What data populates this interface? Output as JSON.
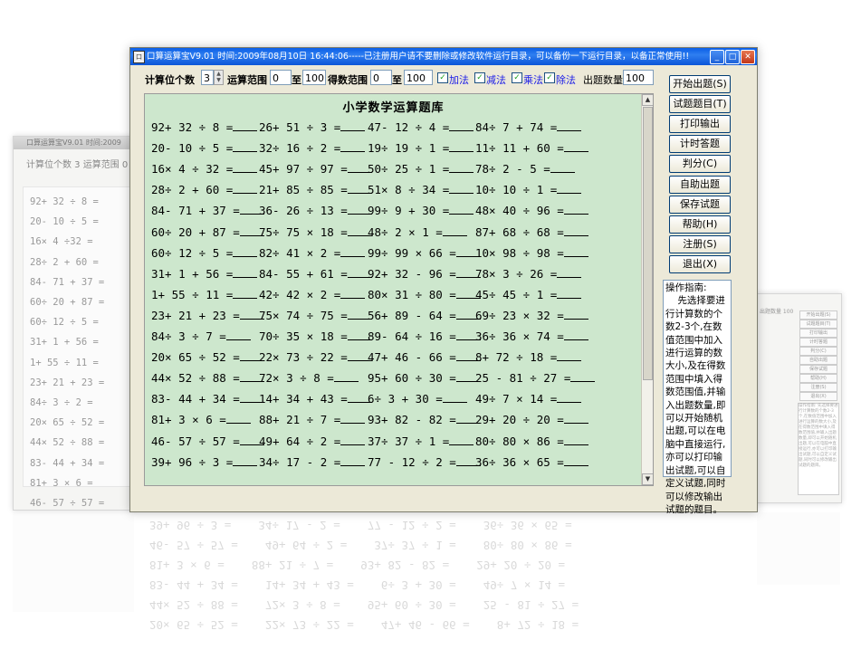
{
  "window": {
    "title": "口算运算宝V9.01   时间:2009年08月10日  16:44:06-----已注册用户请不要删除或修改软件运行目录，可以备份一下运行目录，以备正常使用!!",
    "icon_glyph": "口",
    "min_glyph": "_",
    "max_glyph": "□",
    "close_glyph": "✕"
  },
  "toolbar": {
    "digits_label": "计算位个数",
    "digits_value": "3",
    "range_label": "运算范围",
    "range_from": "0",
    "to_label_1": "至",
    "range_to": "100",
    "result_label": "得数范围",
    "result_from": "0",
    "to_label_2": "至",
    "result_to": "100",
    "ops": {
      "add": "加法",
      "sub": "减法",
      "mul": "乘法",
      "div": "除法"
    },
    "check_glyph": "✓",
    "count_label": "出题数量",
    "count_value": "100"
  },
  "question_area": {
    "title": "小学数学运算题库",
    "rows": [
      [
        "92+ 32 ÷ 8 =",
        "26+ 51 ÷ 3 =",
        "47- 12 ÷ 4 =",
        "84÷ 7 + 74 ="
      ],
      [
        "20- 10 ÷ 5 =",
        "32÷ 16 ÷ 2 =",
        "19÷ 19 ÷ 1 =",
        "11÷ 11 + 60 ="
      ],
      [
        "16× 4 ÷ 32 =",
        "45+ 97 ÷ 97 =",
        "50÷ 25 ÷ 1 =",
        "78÷ 2 - 5 ="
      ],
      [
        "28÷ 2 + 60 =",
        "21+ 85 ÷ 85 =",
        "51× 8 ÷ 34 =",
        "10÷ 10 ÷ 1 ="
      ],
      [
        "84- 71 + 37 =",
        "36- 26 ÷ 13 =",
        "99÷ 9 + 30 =",
        "48× 40 ÷ 96 ="
      ],
      [
        "60÷ 20 + 87 =",
        "75÷ 75 × 18 =",
        "48÷ 2 × 1 =",
        "87+ 68 ÷ 68 ="
      ],
      [
        "60÷ 12 ÷ 5 =",
        "82÷ 41 × 2 =",
        "99÷ 99 × 66 =",
        "10× 98 ÷ 98 ="
      ],
      [
        "31+ 1 + 56 =",
        "84- 55 + 61 =",
        "92+ 32 - 96 =",
        "78× 3 ÷ 26 ="
      ],
      [
        "1+ 55 ÷ 11 =",
        "42÷ 42 × 2 =",
        "80× 31 ÷ 80 =",
        "45÷ 45 ÷ 1 ="
      ],
      [
        "23+ 21 + 23 =",
        "75× 74 ÷ 75 =",
        "56+ 89 - 64 =",
        "69÷ 23 × 32 ="
      ],
      [
        "84÷ 3 ÷ 7 =",
        "70÷ 35 × 18 =",
        "89- 64 ÷ 16 =",
        "36÷ 36 × 74 ="
      ],
      [
        "20× 65 ÷ 52 =",
        "22× 73 ÷ 22 =",
        "47+ 46 - 66 =",
        "8+ 72 ÷ 18 ="
      ],
      [
        "44× 52 ÷ 88 =",
        "72× 3 ÷ 8 =",
        "95+ 60 ÷ 30 =",
        "25 - 81 ÷ 27 ="
      ],
      [
        "83- 44 + 34 =",
        "14+ 34 + 43 =",
        "6÷ 3 + 30 =",
        "49÷ 7 × 14 ="
      ],
      [
        "81+ 3 × 6 =",
        "88+ 21 ÷ 7 =",
        "93+ 82 - 82 =",
        "29+ 20 ÷ 20 ="
      ],
      [
        "46- 57 ÷ 57 =",
        "49+ 64 ÷ 2 =",
        "37÷ 37 ÷ 1 =",
        "80÷ 80 × 86 ="
      ],
      [
        "39+ 96 ÷ 3 =",
        "34÷ 17 - 2 =",
        "77 - 12 ÷ 2 =",
        "36÷ 36 × 65 ="
      ]
    ],
    "scroll_up": "▲",
    "scroll_down": "▼"
  },
  "buttons": [
    {
      "label": "开始出题(S)",
      "name": "start-button"
    },
    {
      "label": "试题题目(T)",
      "name": "questions-button"
    },
    {
      "label": "打印输出",
      "name": "print-button"
    },
    {
      "label": "计时答题",
      "name": "timed-answer-button"
    },
    {
      "label": "判分(C)",
      "name": "grade-button"
    },
    {
      "label": "自助出题",
      "name": "self-question-button"
    },
    {
      "label": "保存试题",
      "name": "save-questions-button"
    },
    {
      "label": "帮助(H)",
      "name": "help-button"
    },
    {
      "label": "注册(S)",
      "name": "register-button"
    },
    {
      "label": "退出(X)",
      "name": "exit-button"
    }
  ],
  "guide": {
    "text": "操作指南:\n    先选择要进行计算数的个数2-3个,在数值范围中加入进行运算的数大小,及在得数范围中填入得数范围值,并输入出题数量,即可以开始随机出题,可以在电脑中直接运行,亦可以打印输出试题,可以自定义试题,同时可以修改输出试题的题目。"
  },
  "bg_left": {
    "title": "口算运算宝V9.01  时间:2009",
    "ctl": "计算位个数 3  运算范围 0",
    "rows": [
      "92+ 32 ÷ 8 =",
      "20- 10 ÷ 5 =",
      "16× 4 ÷32 =",
      "28÷ 2 + 60 =",
      "84- 71 + 37 =",
      "60÷ 20 + 87 =",
      "60÷ 12 ÷ 5 =",
      "31+ 1 + 56 =",
      "1+ 55 ÷ 11 =",
      "23+ 21 + 23 =",
      "84÷ 3 ÷ 2 =",
      "20× 65 ÷ 52 =",
      "44× 52 ÷ 88 =",
      "83- 44 + 34 =",
      "81+ 3 × 6 =",
      "46- 57 ÷ 57 =",
      "39+ 96 ÷ 3 ="
    ]
  },
  "bg_right": {
    "ctl": "出题数量 100",
    "buttons": [
      "开始出题(S)",
      "试题题目(T)",
      "打印输出",
      "计时答题",
      "判分(C)",
      "自助出题",
      "保存试题",
      "帮助(H)",
      "注册(S)",
      "退出(X)"
    ],
    "guide": "操作指南: 先选择要进行计算数的个数2-3个,在数值范围中加入进行运算的数大小,及在得数范围中填入得数范围值,并输入出题数量,即可以开始随机出题,可以在电脑中直接运行,亦可以打印输出试题,可以自定义试题,同时可以修改输出试题的题目。"
  }
}
